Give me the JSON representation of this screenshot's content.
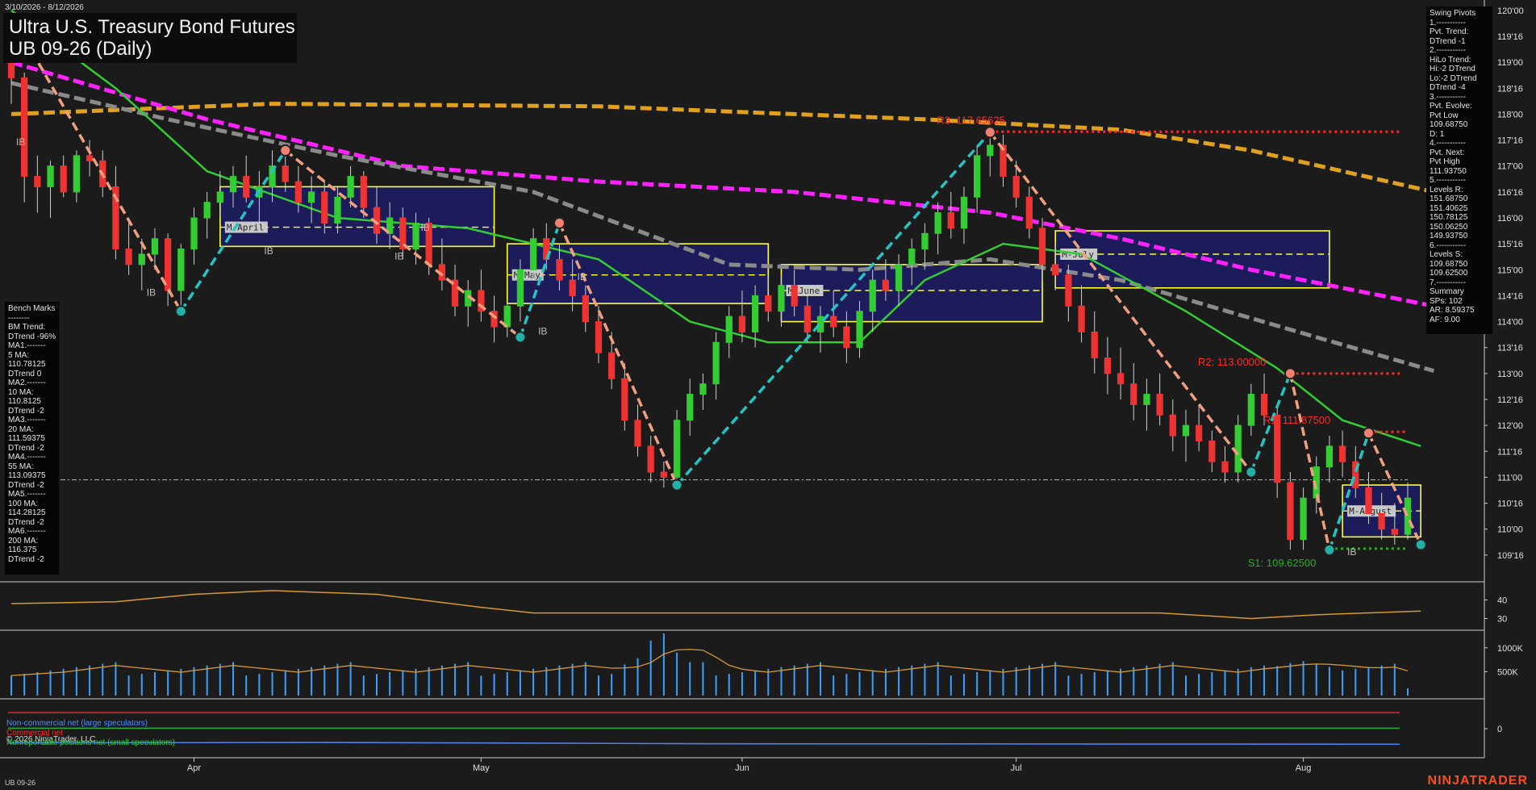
{
  "header": {
    "date_range": "3/10/2026 - 8/12/2026",
    "title": "Ultra U.S. Treasury Bond Futures",
    "subtitle": "UB 09-26 (Daily)"
  },
  "swing_pivots": [
    "Swing Pivots",
    "1.-----------",
    "Pvt. Trend:",
    "DTrend -1",
    "2.-----------",
    "HiLo Trend:",
    "Hi:-2 DTrend",
    "Lo:-2 DTrend",
    "DTrend -4",
    "3.-----------",
    "Pvt. Evolve:",
    "Pvt Low",
    "109.68750",
    "D: 1",
    "4.-----------",
    "Pvt. Next:",
    "Pvt High",
    "111.93750",
    "5.-----------",
    "Levels R:",
    "151.68750",
    "151.40625",
    "150.78125",
    "150.06250",
    "149.93750",
    "6.-----------",
    "Levels S:",
    "109.68750",
    "109.62500",
    "7.-----------",
    "Summary",
    "SPs: 102",
    "AR: 8.59375",
    "AF: 9.00"
  ],
  "benchmarks": [
    "Bench Marks",
    "--------",
    "BM Trend:",
    "DTrend -96%",
    "MA1.-------",
    "5 MA:",
    "110.78125",
    "DTrend 0",
    "MA2.-------",
    "10 MA:",
    "110.8125",
    "DTrend -2",
    "MA3.-------",
    "20 MA:",
    "111.59375",
    "DTrend -2",
    "MA4.-------",
    "55 MA:",
    "113.09375",
    "DTrend -2",
    "MA5.-------",
    "100 MA:",
    "114.28125",
    "DTrend -2",
    "MA6.-------",
    "200 MA:",
    "116.375",
    "DTrend -2"
  ],
  "chart_data": {
    "type": "candlestick",
    "price_axis": {
      "ticks": [
        "120'00",
        "119'16",
        "119'00",
        "118'16",
        "118'00",
        "117'16",
        "117'00",
        "116'16",
        "116'00",
        "115'16",
        "115'00",
        "114'16",
        "114'00",
        "113'16",
        "113'00",
        "112'16",
        "112'00",
        "111'16",
        "111'00",
        "110'16",
        "110'00",
        "109'16"
      ],
      "tick_values": [
        120.0,
        119.5,
        119.0,
        118.5,
        118.0,
        117.5,
        117.0,
        116.5,
        116.0,
        115.5,
        115.0,
        114.5,
        114.0,
        113.5,
        113.0,
        112.5,
        112.0,
        111.5,
        111.0,
        110.5,
        110.0,
        109.5
      ],
      "ylim": [
        109.0,
        120.2
      ]
    },
    "month_labels": [
      "Apr",
      "May",
      "Jun",
      "Jul",
      "Aug"
    ],
    "month_index": [
      14,
      36,
      56,
      77,
      99
    ],
    "pivot_labels": [
      {
        "text": "R3: 117.65625",
        "color": "#ff2a2a",
        "index": 76,
        "price": 117.66
      },
      {
        "text": "R2: 113.00000",
        "color": "#ff2a2a",
        "index": 96,
        "price": 113.0
      },
      {
        "text": "R1: 111.87500",
        "color": "#ff2a2a",
        "index": 101,
        "price": 111.875
      },
      {
        "text": "S1: 109.62500",
        "color": "#1fb31f",
        "index": 100,
        "price": 109.625
      }
    ],
    "month_boxes": [
      {
        "label": "M-April",
        "start": 16,
        "end": 37,
        "high": 116.6,
        "low": 115.45,
        "mid": 115.82
      },
      {
        "label": "M-May",
        "start": 38,
        "end": 58,
        "high": 115.5,
        "low": 114.35,
        "mid": 114.9
      },
      {
        "label": "M-June",
        "start": 59,
        "end": 79,
        "high": 115.1,
        "low": 114.0,
        "mid": 114.6
      },
      {
        "label": "M-July",
        "start": 80,
        "end": 101,
        "high": 115.75,
        "low": 114.65,
        "mid": 115.3
      },
      {
        "label": "M-August",
        "start": 102,
        "end": 108,
        "high": 110.85,
        "low": 109.85,
        "mid": 110.35
      }
    ],
    "ib_labels": [
      {
        "text": "IB",
        "index": 0,
        "price": 117.4
      },
      {
        "text": "IB",
        "index": 10,
        "price": 114.5
      },
      {
        "text": "IB",
        "index": 19,
        "price": 115.3
      },
      {
        "text": "IB",
        "index": 29,
        "price": 115.2
      },
      {
        "text": "IB",
        "index": 31,
        "price": 115.75
      },
      {
        "text": "IB",
        "index": 40,
        "price": 113.75
      },
      {
        "text": "IB",
        "index": 43,
        "price": 114.8
      },
      {
        "text": "IB",
        "index": 102,
        "price": 109.5
      }
    ],
    "zigzag": [
      {
        "i": 0,
        "p": 119.9
      },
      {
        "i": 13,
        "p": 114.2
      },
      {
        "i": 21,
        "p": 117.3
      },
      {
        "i": 39,
        "p": 113.7
      },
      {
        "i": 42,
        "p": 115.9
      },
      {
        "i": 51,
        "p": 110.85
      },
      {
        "i": 75,
        "p": 117.65
      },
      {
        "i": 95,
        "p": 111.1
      },
      {
        "i": 98,
        "p": 113.0
      },
      {
        "i": 101,
        "p": 109.6
      },
      {
        "i": 104,
        "p": 111.85
      },
      {
        "i": 108,
        "p": 109.7
      }
    ],
    "moving_averages": [
      {
        "name": "200 MA",
        "color": "#e0a020",
        "dash": true,
        "points": [
          [
            0,
            118.0
          ],
          [
            20,
            118.2
          ],
          [
            45,
            118.15
          ],
          [
            70,
            117.9
          ],
          [
            85,
            117.7
          ],
          [
            95,
            117.3
          ],
          [
            109,
            116.5
          ]
        ]
      },
      {
        "name": "100 MA",
        "color": "#ff22ff",
        "dash": true,
        "points": [
          [
            0,
            119.0
          ],
          [
            15,
            117.9
          ],
          [
            30,
            117.0
          ],
          [
            45,
            116.7
          ],
          [
            60,
            116.5
          ],
          [
            75,
            116.1
          ],
          [
            85,
            115.6
          ],
          [
            95,
            115.0
          ],
          [
            109,
            114.3
          ]
        ]
      },
      {
        "name": "55 MA",
        "color": "#8a8a8a",
        "dash": true,
        "points": [
          [
            0,
            118.6
          ],
          [
            12,
            117.9
          ],
          [
            25,
            117.2
          ],
          [
            40,
            116.5
          ],
          [
            55,
            115.1
          ],
          [
            65,
            115.0
          ],
          [
            75,
            115.2
          ],
          [
            85,
            114.8
          ],
          [
            100,
            113.7
          ],
          [
            109,
            113.05
          ]
        ]
      },
      {
        "name": "20 MA",
        "color": "#33cc33",
        "dash": false,
        "points": [
          [
            0,
            120.0
          ],
          [
            8,
            118.5
          ],
          [
            15,
            116.9
          ],
          [
            25,
            116.0
          ],
          [
            35,
            115.8
          ],
          [
            45,
            115.2
          ],
          [
            52,
            114.0
          ],
          [
            58,
            113.6
          ],
          [
            65,
            113.6
          ],
          [
            70,
            114.8
          ],
          [
            76,
            115.5
          ],
          [
            82,
            115.3
          ],
          [
            90,
            114.2
          ],
          [
            97,
            113.1
          ],
          [
            102,
            112.1
          ],
          [
            108,
            111.6
          ]
        ]
      }
    ],
    "candles": [
      [
        119.0,
        119.4,
        118.2,
        118.7
      ],
      [
        118.7,
        118.8,
        116.3,
        116.8
      ],
      [
        116.8,
        117.2,
        116.1,
        116.6
      ],
      [
        116.6,
        117.1,
        116.0,
        117.0
      ],
      [
        117.0,
        117.2,
        116.4,
        116.5
      ],
      [
        116.5,
        117.3,
        116.3,
        117.2
      ],
      [
        117.2,
        117.5,
        116.8,
        117.1
      ],
      [
        117.1,
        117.3,
        116.4,
        116.6
      ],
      [
        116.6,
        117.0,
        115.2,
        115.4
      ],
      [
        115.4,
        115.9,
        114.9,
        115.1
      ],
      [
        115.1,
        115.6,
        114.6,
        115.3
      ],
      [
        115.3,
        115.8,
        115.0,
        115.6
      ],
      [
        115.6,
        115.7,
        114.3,
        114.6
      ],
      [
        114.6,
        115.5,
        114.2,
        115.4
      ],
      [
        115.4,
        116.2,
        115.1,
        116.0
      ],
      [
        116.0,
        116.5,
        115.6,
        116.3
      ],
      [
        116.3,
        116.9,
        116.0,
        116.5
      ],
      [
        116.5,
        117.0,
        116.2,
        116.8
      ],
      [
        116.8,
        117.2,
        116.3,
        116.4
      ],
      [
        116.4,
        116.9,
        115.9,
        116.6
      ],
      [
        116.6,
        117.3,
        116.3,
        117.0
      ],
      [
        117.0,
        117.4,
        116.5,
        116.7
      ],
      [
        116.7,
        117.0,
        116.1,
        116.3
      ],
      [
        116.3,
        116.8,
        115.9,
        116.5
      ],
      [
        116.5,
        116.7,
        115.7,
        115.9
      ],
      [
        115.9,
        116.6,
        115.7,
        116.4
      ],
      [
        116.4,
        117.0,
        116.2,
        116.8
      ],
      [
        116.8,
        116.9,
        116.0,
        116.2
      ],
      [
        116.2,
        116.6,
        115.5,
        115.7
      ],
      [
        115.7,
        116.3,
        115.4,
        116.0
      ],
      [
        116.0,
        116.2,
        115.2,
        115.4
      ],
      [
        115.4,
        116.1,
        115.1,
        115.9
      ],
      [
        115.9,
        116.0,
        114.9,
        115.1
      ],
      [
        115.1,
        115.6,
        114.6,
        114.8
      ],
      [
        114.8,
        115.1,
        114.1,
        114.3
      ],
      [
        114.3,
        114.8,
        113.9,
        114.6
      ],
      [
        114.6,
        115.0,
        114.0,
        114.2
      ],
      [
        114.2,
        114.5,
        113.6,
        113.9
      ],
      [
        113.9,
        114.4,
        113.7,
        114.3
      ],
      [
        114.3,
        115.2,
        114.0,
        115.0
      ],
      [
        115.0,
        115.8,
        114.8,
        115.6
      ],
      [
        115.6,
        115.9,
        115.0,
        115.2
      ],
      [
        115.2,
        115.5,
        114.6,
        114.8
      ],
      [
        114.8,
        115.2,
        114.2,
        114.5
      ],
      [
        114.5,
        114.7,
        113.8,
        114.0
      ],
      [
        114.0,
        114.3,
        113.2,
        113.4
      ],
      [
        113.4,
        113.8,
        112.7,
        112.9
      ],
      [
        112.9,
        113.2,
        111.9,
        112.1
      ],
      [
        112.1,
        112.4,
        111.4,
        111.6
      ],
      [
        111.6,
        111.8,
        110.9,
        111.1
      ],
      [
        111.1,
        111.3,
        110.8,
        111.0
      ],
      [
        111.0,
        112.3,
        110.9,
        112.1
      ],
      [
        112.1,
        112.9,
        111.8,
        112.6
      ],
      [
        112.6,
        113.0,
        112.3,
        112.8
      ],
      [
        112.8,
        113.8,
        112.5,
        113.6
      ],
      [
        113.6,
        114.3,
        113.3,
        114.1
      ],
      [
        114.1,
        114.6,
        113.6,
        113.8
      ],
      [
        113.8,
        114.7,
        113.5,
        114.5
      ],
      [
        114.5,
        114.9,
        114.0,
        114.2
      ],
      [
        114.2,
        114.9,
        113.9,
        114.7
      ],
      [
        114.7,
        115.0,
        114.1,
        114.3
      ],
      [
        114.3,
        114.6,
        113.6,
        113.8
      ],
      [
        113.8,
        114.3,
        113.4,
        114.1
      ],
      [
        114.1,
        114.6,
        113.7,
        113.9
      ],
      [
        113.9,
        114.2,
        113.2,
        113.5
      ],
      [
        113.5,
        114.4,
        113.3,
        114.2
      ],
      [
        114.2,
        115.0,
        113.8,
        114.8
      ],
      [
        114.8,
        115.2,
        114.4,
        114.6
      ],
      [
        114.6,
        115.3,
        114.3,
        115.1
      ],
      [
        115.1,
        115.6,
        114.7,
        115.4
      ],
      [
        115.4,
        115.9,
        115.0,
        115.7
      ],
      [
        115.7,
        116.3,
        115.3,
        116.1
      ],
      [
        116.1,
        116.5,
        115.6,
        115.8
      ],
      [
        115.8,
        116.6,
        115.5,
        116.4
      ],
      [
        116.4,
        117.4,
        116.1,
        117.2
      ],
      [
        117.2,
        117.7,
        116.8,
        117.4
      ],
      [
        117.4,
        117.6,
        116.6,
        116.8
      ],
      [
        116.8,
        117.1,
        116.2,
        116.4
      ],
      [
        116.4,
        116.6,
        115.6,
        115.8
      ],
      [
        115.8,
        116.0,
        114.8,
        115.1
      ],
      [
        115.1,
        115.5,
        114.6,
        114.9
      ],
      [
        114.9,
        115.1,
        114.0,
        114.3
      ],
      [
        114.3,
        114.7,
        113.6,
        113.8
      ],
      [
        113.8,
        114.2,
        113.0,
        113.3
      ],
      [
        113.3,
        113.7,
        112.6,
        113.0
      ],
      [
        113.0,
        113.5,
        112.5,
        112.8
      ],
      [
        112.8,
        113.2,
        112.1,
        112.4
      ],
      [
        112.4,
        112.9,
        111.9,
        112.6
      ],
      [
        112.6,
        113.0,
        112.0,
        112.2
      ],
      [
        112.2,
        112.5,
        111.5,
        111.8
      ],
      [
        111.8,
        112.3,
        111.3,
        112.0
      ],
      [
        112.0,
        112.4,
        111.5,
        111.7
      ],
      [
        111.7,
        111.9,
        111.1,
        111.3
      ],
      [
        111.3,
        111.6,
        110.9,
        111.1
      ],
      [
        111.1,
        112.2,
        110.9,
        112.0
      ],
      [
        112.0,
        112.8,
        111.8,
        112.6
      ],
      [
        112.6,
        113.0,
        112.0,
        112.2
      ],
      [
        112.2,
        112.4,
        110.6,
        110.9
      ],
      [
        110.9,
        111.1,
        109.6,
        109.8
      ],
      [
        109.8,
        110.8,
        109.6,
        110.6
      ],
      [
        110.6,
        111.4,
        110.3,
        111.2
      ],
      [
        111.2,
        111.8,
        110.9,
        111.6
      ],
      [
        111.6,
        111.9,
        111.0,
        111.3
      ],
      [
        111.3,
        111.6,
        110.6,
        110.8
      ],
      [
        110.8,
        111.1,
        110.1,
        110.3
      ],
      [
        110.3,
        110.7,
        109.8,
        110.0
      ],
      [
        110.0,
        110.5,
        109.7,
        109.9
      ],
      [
        109.9,
        110.9,
        109.8,
        110.6
      ]
    ],
    "oscillator": {
      "ticks": [
        "40",
        "30"
      ],
      "tick_values": [
        40,
        30
      ],
      "ylim": [
        25,
        48
      ]
    },
    "volume": {
      "ticks": [
        "1000K",
        "500K"
      ],
      "tick_values": [
        1000,
        500
      ],
      "ylim": [
        0,
        1300
      ]
    },
    "cot": {
      "ticks": [
        "0"
      ],
      "tick_values": [
        0
      ],
      "ylim": [
        -3,
        3
      ]
    },
    "cot_legend": [
      {
        "text": "Non-commercial net (large speculators)",
        "color": "#4f8fff"
      },
      {
        "text": "Commercial net",
        "color": "#ff2a2a"
      },
      {
        "text": "© 2026 NinjaTrader, LLC",
        "color": "#dddddd"
      },
      {
        "text": "Nonreportable positions net (small speculators)",
        "color": "#33cc33"
      }
    ]
  },
  "footer": {
    "ticker": "UB 09-26",
    "brand": "NINJATRADER"
  }
}
